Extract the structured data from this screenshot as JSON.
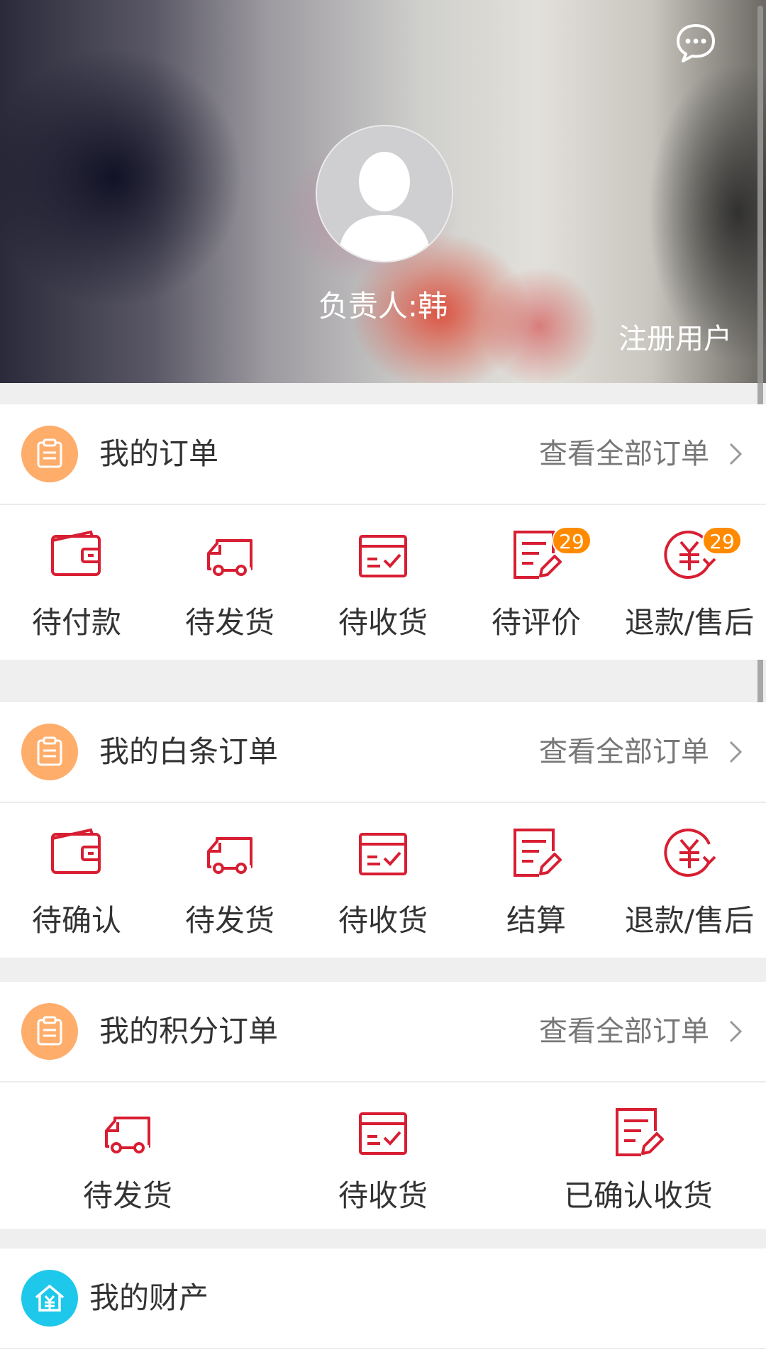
{
  "header": {
    "person_name": "负责人:韩",
    "register_link": "注册用户",
    "message_icon": "chat-bubble-icon",
    "avatar_icon": "default-avatar-icon"
  },
  "colors": {
    "accent_red": "#d81e32",
    "section_icon_orange": "#ffad6b",
    "asset_icon_cyan": "#1ec8ea",
    "badge_orange": "#ff8a00"
  },
  "orders": {
    "title": "我的订单",
    "view_all": "查看全部订单",
    "items": [
      {
        "label": "待付款",
        "icon": "wallet-icon"
      },
      {
        "label": "待发货",
        "icon": "truck-icon"
      },
      {
        "label": "待收货",
        "icon": "box-check-icon"
      },
      {
        "label": "待评价",
        "icon": "edit-document-icon",
        "badge": "29"
      },
      {
        "label": "退款/售后",
        "icon": "yuan-refund-icon",
        "badge": "29"
      }
    ]
  },
  "credit_orders": {
    "title": "我的白条订单",
    "view_all": "查看全部订单",
    "items": [
      {
        "label": "待确认",
        "icon": "wallet-icon"
      },
      {
        "label": "待发货",
        "icon": "truck-icon"
      },
      {
        "label": "待收货",
        "icon": "box-check-icon"
      },
      {
        "label": "结算",
        "icon": "edit-document-icon"
      },
      {
        "label": "退款/售后",
        "icon": "yuan-refund-icon"
      }
    ]
  },
  "points_orders": {
    "title": "我的积分订单",
    "view_all": "查看全部订单",
    "items": [
      {
        "label": "待发货",
        "icon": "truck-icon"
      },
      {
        "label": "待收货",
        "icon": "box-check-icon"
      },
      {
        "label": "已确认收货",
        "icon": "edit-document-icon"
      }
    ]
  },
  "assets": {
    "title": "我的财产",
    "icon": "house-yuan-icon"
  }
}
